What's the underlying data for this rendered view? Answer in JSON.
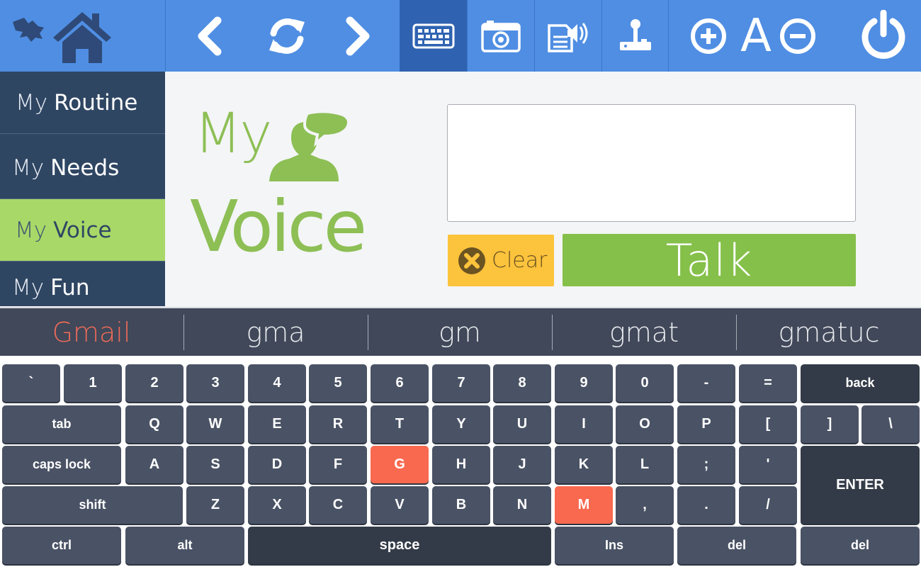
{
  "toolbar": {
    "icons": [
      "home-icon",
      "back-arrow-icon",
      "refresh-icon",
      "forward-arrow-icon",
      "keyboard-icon",
      "camera-icon",
      "read-aloud-icon",
      "joystick-icon",
      "zoom-in-icon",
      "font-size-icon",
      "zoom-out-icon",
      "power-icon"
    ],
    "font_label": "A",
    "active": "keyboard"
  },
  "sidebar": {
    "items": [
      {
        "pre": "My",
        "main": "Routine"
      },
      {
        "pre": "My",
        "main": "Needs"
      },
      {
        "pre": "My",
        "main": "Voice",
        "active": true
      },
      {
        "pre": "My",
        "main": "Fun"
      }
    ]
  },
  "main": {
    "title_my": "My",
    "title_voice": "Voice",
    "text_value": "",
    "clear_label": "Clear",
    "talk_label": "Talk"
  },
  "suggestions": [
    "Gmail",
    "gma",
    "gm",
    "gmat",
    "gmatuc"
  ],
  "keyboard": {
    "rows": [
      [
        "`",
        "1",
        "2",
        "3",
        "4",
        "5",
        "6",
        "7",
        "8",
        "9",
        "0",
        "-",
        "=",
        "back"
      ],
      [
        "tab",
        "Q",
        "W",
        "E",
        "R",
        "T",
        "Y",
        "U",
        "I",
        "O",
        "P",
        "[",
        "]",
        "\\"
      ],
      [
        "caps lock",
        "A",
        "S",
        "D",
        "F",
        "G",
        "H",
        "J",
        "K",
        "L",
        ";",
        "'",
        "ENTER"
      ],
      [
        "shift",
        "Z",
        "X",
        "C",
        "V",
        "B",
        "N",
        "M",
        ",",
        ".",
        "/"
      ],
      [
        "ctrl",
        "alt",
        "space",
        "Ins",
        "del",
        "del"
      ]
    ],
    "highlighted": [
      "G",
      "M"
    ]
  },
  "colors": {
    "topbar": "#4f8ee3",
    "sidebar": "#2f4663",
    "accent_green": "#85c04a",
    "clear_yellow": "#fcc33c",
    "highlight": "#f8694f"
  }
}
